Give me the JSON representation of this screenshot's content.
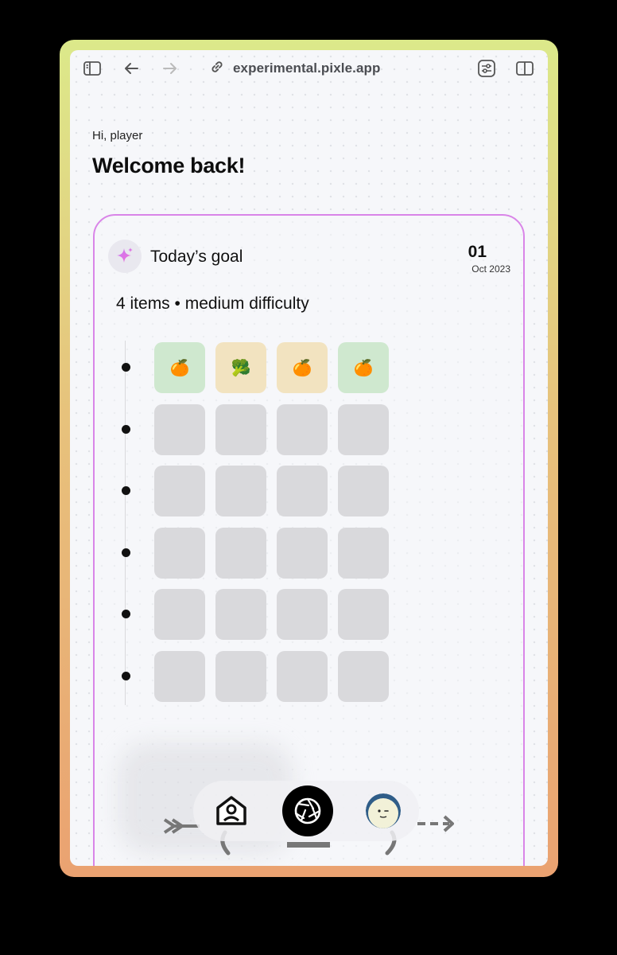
{
  "browser": {
    "url": "experimental.pixle.app",
    "icons": [
      "sidebar-icon",
      "back-arrow-icon",
      "forward-arrow-icon",
      "link-icon",
      "sliders-icon",
      "split-view-icon"
    ]
  },
  "header": {
    "greeting": "Hi, player",
    "welcome": "Welcome back!"
  },
  "goal": {
    "title": "Today’s goal",
    "date_day": "01",
    "date_month": "Oct 2023",
    "meta": "4 items • medium difficulty",
    "icon": "sparkle-icon"
  },
  "grid": {
    "rows": [
      [
        {
          "emoji": "🍊",
          "state": "correct"
        },
        {
          "emoji": "🥦",
          "state": "partial"
        },
        {
          "emoji": "🍊",
          "state": "partial"
        },
        {
          "emoji": "🍊",
          "state": "correct"
        }
      ],
      [
        {
          "emoji": "",
          "state": "empty"
        },
        {
          "emoji": "",
          "state": "empty"
        },
        {
          "emoji": "",
          "state": "empty"
        },
        {
          "emoji": "",
          "state": "empty"
        }
      ],
      [
        {
          "emoji": "",
          "state": "empty"
        },
        {
          "emoji": "",
          "state": "empty"
        },
        {
          "emoji": "",
          "state": "empty"
        },
        {
          "emoji": "",
          "state": "empty"
        }
      ],
      [
        {
          "emoji": "",
          "state": "empty"
        },
        {
          "emoji": "",
          "state": "empty"
        },
        {
          "emoji": "",
          "state": "empty"
        },
        {
          "emoji": "",
          "state": "empty"
        }
      ],
      [
        {
          "emoji": "",
          "state": "empty"
        },
        {
          "emoji": "",
          "state": "empty"
        },
        {
          "emoji": "",
          "state": "empty"
        },
        {
          "emoji": "",
          "state": "empty"
        }
      ],
      [
        {
          "emoji": "",
          "state": "empty"
        },
        {
          "emoji": "",
          "state": "empty"
        },
        {
          "emoji": "",
          "state": "empty"
        },
        {
          "emoji": "",
          "state": "empty"
        }
      ]
    ]
  },
  "nav": {
    "items": [
      "home-icon",
      "camera-shutter-icon",
      "avatar"
    ]
  },
  "colors": {
    "accent_border": "#d985e8",
    "tile_correct": "#cfe8cf",
    "tile_partial": "#f2e3c0",
    "tile_empty": "#d9d9dc",
    "sparkle": "#d26ff0"
  }
}
